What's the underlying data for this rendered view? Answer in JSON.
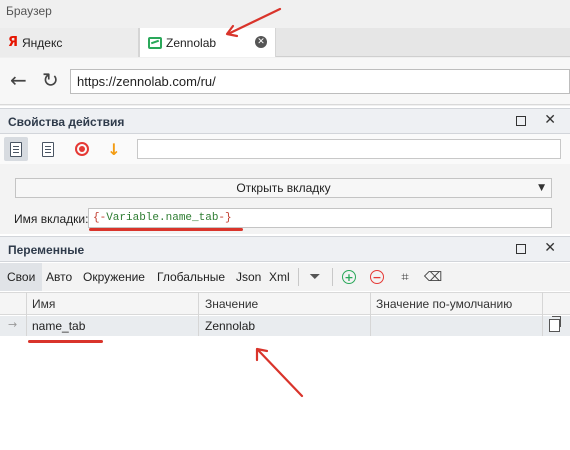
{
  "browser": {
    "title": "Браузер",
    "tabs": [
      {
        "label": "Яндекс",
        "icon": "yandex-icon"
      },
      {
        "label": "Zennolab",
        "icon": "zennolab-icon",
        "active": true
      }
    ],
    "address": "https://zennolab.com/ru/"
  },
  "props": {
    "title": "Свойства действия",
    "action_value": "Открыть вкладку",
    "tabname_label": "Имя вкладки:",
    "tabname_open": "{-",
    "tabname_var": "Variable.name_tab",
    "tabname_close": "-}"
  },
  "variables": {
    "title": "Переменные",
    "tabs": [
      "Свои",
      "Авто",
      "Окружение",
      "Глобальные",
      "Json",
      "Xml"
    ],
    "columns": [
      "Имя",
      "Значение",
      "Значение по-умолчанию"
    ],
    "rows": [
      {
        "name": "name_tab",
        "value": "Zennolab",
        "default": ""
      }
    ]
  },
  "colors": {
    "annotation": "#d9342b",
    "accent_green": "#2aa85a",
    "accent_red": "#e53935"
  }
}
